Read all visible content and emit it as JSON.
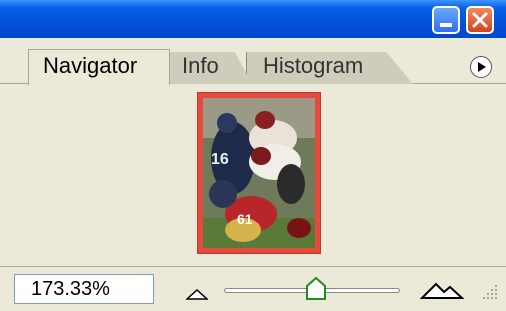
{
  "tabs": [
    {
      "label": "Navigator",
      "active": true
    },
    {
      "label": "Info",
      "active": false
    },
    {
      "label": "Histogram",
      "active": false
    }
  ],
  "zoom": {
    "value": "173.33%",
    "slider_fraction": 0.52
  },
  "icons": {
    "minimize": "minimize-icon",
    "close": "close-icon",
    "panel_menu": "play-arrow-icon",
    "zoom_out": "small-mountain-icon",
    "zoom_in": "large-mountain-icon"
  },
  "colors": {
    "title_bar": "#0351da",
    "close_button": "#d2441c",
    "view_box": "#e64a3c",
    "panel_bg": "#ece9d8"
  }
}
